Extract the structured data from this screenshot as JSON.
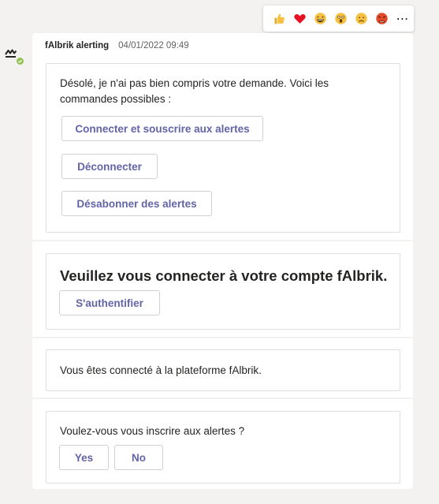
{
  "reactions": [
    {
      "icon": "thumbs-up-icon",
      "label": "like"
    },
    {
      "icon": "heart-icon",
      "label": "heart"
    },
    {
      "icon": "laughing-face-icon",
      "label": "laugh"
    },
    {
      "icon": "surprised-face-icon",
      "label": "surprised"
    },
    {
      "icon": "sad-face-icon",
      "label": "sad"
    },
    {
      "icon": "angry-face-icon",
      "label": "angry"
    }
  ],
  "more_options": "⋯",
  "message": {
    "sender": "fAlbrik alerting",
    "timestamp": "04/01/2022 09:49"
  },
  "card1": {
    "text": "Désolé, je n'ai pas bien compris votre demande. Voici les commandes possibles :",
    "buttons": [
      "Connecter et souscrire aux alertes",
      "Déconnecter",
      "Désabonner des alertes"
    ]
  },
  "card2": {
    "title": "Veuillez vous connecter à votre compte fAlbrik.",
    "button": "S'authentifier"
  },
  "card3": {
    "text": "Vous êtes connecté à la plateforme fAlbrik."
  },
  "card4": {
    "text": "Voulez-vous vous inscrire aux alertes ?",
    "yes": "Yes",
    "no": "No"
  },
  "colors": {
    "accent": "#6264a7",
    "presence": "#92c353",
    "background": "#f3f2f1"
  }
}
